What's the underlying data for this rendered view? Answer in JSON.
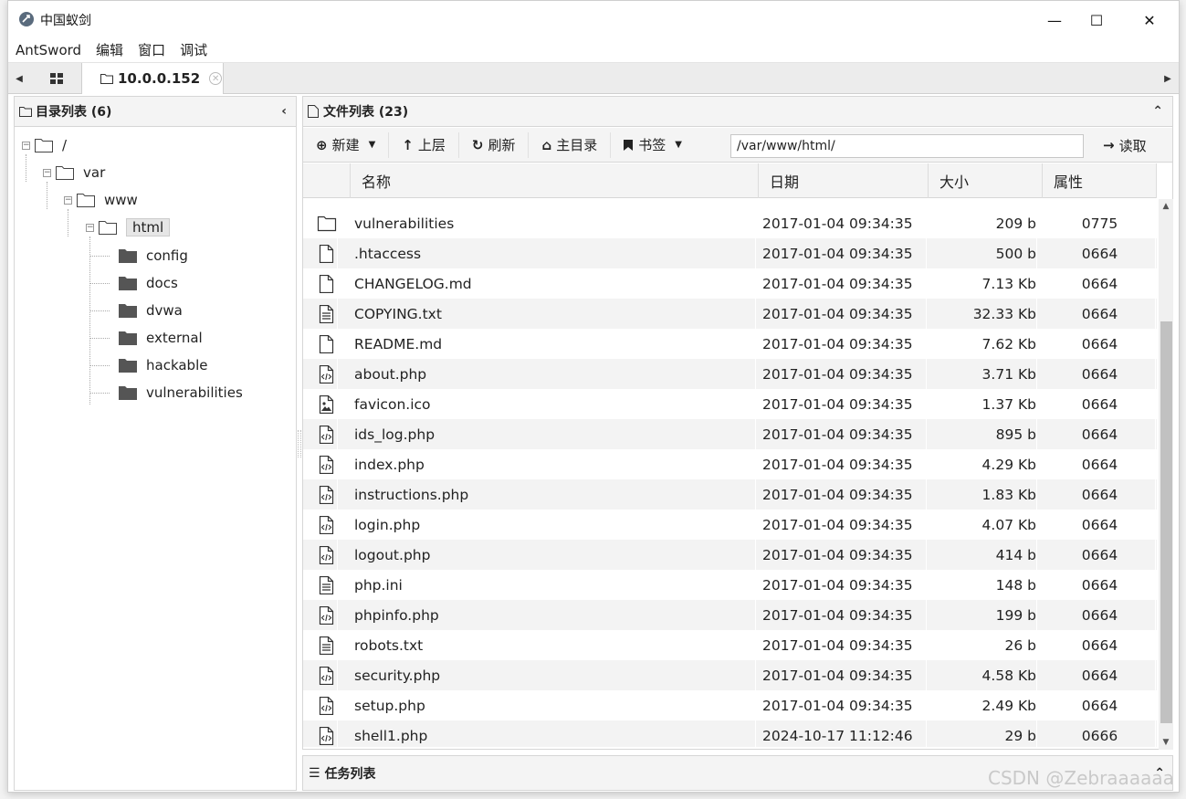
{
  "window": {
    "title": "中国蚁剑",
    "minimize": "—",
    "maximize": "☐",
    "close": "✕"
  },
  "menu": [
    "AntSword",
    "编辑",
    "窗口",
    "调试"
  ],
  "tabs": {
    "active_label": "10.0.0.152",
    "close_glyph": "✕"
  },
  "dir_panel": {
    "title": "目录列表 (6)",
    "collapse": "‹",
    "tree": [
      {
        "label": "/"
      },
      {
        "label": "var"
      },
      {
        "label": "www"
      },
      {
        "label": "html"
      },
      {
        "label": "config"
      },
      {
        "label": "docs"
      },
      {
        "label": "dvwa"
      },
      {
        "label": "external"
      },
      {
        "label": "hackable"
      },
      {
        "label": "vulnerabilities"
      }
    ]
  },
  "file_panel": {
    "title": "文件列表 (23)",
    "collapse": "⌃",
    "toolbar": {
      "new": "新建",
      "up": "上层",
      "refresh": "刷新",
      "home": "主目录",
      "bookmark": "书签",
      "path": "/var/www/html/",
      "read": "读取"
    },
    "columns": {
      "name": "名称",
      "date": "日期",
      "size": "大小",
      "attr": "属性"
    },
    "files": [
      {
        "icon": "folder",
        "name": "vulnerabilities",
        "date": "2017-01-04 09:34:35",
        "size": "209 b",
        "attr": "0775"
      },
      {
        "icon": "file",
        "name": ".htaccess",
        "date": "2017-01-04 09:34:35",
        "size": "500 b",
        "attr": "0664"
      },
      {
        "icon": "file",
        "name": "CHANGELOG.md",
        "date": "2017-01-04 09:34:35",
        "size": "7.13 Kb",
        "attr": "0664"
      },
      {
        "icon": "text",
        "name": "COPYING.txt",
        "date": "2017-01-04 09:34:35",
        "size": "32.33 Kb",
        "attr": "0664"
      },
      {
        "icon": "file",
        "name": "README.md",
        "date": "2017-01-04 09:34:35",
        "size": "7.62 Kb",
        "attr": "0664"
      },
      {
        "icon": "code",
        "name": "about.php",
        "date": "2017-01-04 09:34:35",
        "size": "3.71 Kb",
        "attr": "0664"
      },
      {
        "icon": "image",
        "name": "favicon.ico",
        "date": "2017-01-04 09:34:35",
        "size": "1.37 Kb",
        "attr": "0664"
      },
      {
        "icon": "code",
        "name": "ids_log.php",
        "date": "2017-01-04 09:34:35",
        "size": "895 b",
        "attr": "0664"
      },
      {
        "icon": "code",
        "name": "index.php",
        "date": "2017-01-04 09:34:35",
        "size": "4.29 Kb",
        "attr": "0664"
      },
      {
        "icon": "code",
        "name": "instructions.php",
        "date": "2017-01-04 09:34:35",
        "size": "1.83 Kb",
        "attr": "0664"
      },
      {
        "icon": "code",
        "name": "login.php",
        "date": "2017-01-04 09:34:35",
        "size": "4.07 Kb",
        "attr": "0664"
      },
      {
        "icon": "code",
        "name": "logout.php",
        "date": "2017-01-04 09:34:35",
        "size": "414 b",
        "attr": "0664"
      },
      {
        "icon": "text",
        "name": "php.ini",
        "date": "2017-01-04 09:34:35",
        "size": "148 b",
        "attr": "0664"
      },
      {
        "icon": "code",
        "name": "phpinfo.php",
        "date": "2017-01-04 09:34:35",
        "size": "199 b",
        "attr": "0664"
      },
      {
        "icon": "text",
        "name": "robots.txt",
        "date": "2017-01-04 09:34:35",
        "size": "26 b",
        "attr": "0664"
      },
      {
        "icon": "code",
        "name": "security.php",
        "date": "2017-01-04 09:34:35",
        "size": "4.58 Kb",
        "attr": "0664"
      },
      {
        "icon": "code",
        "name": "setup.php",
        "date": "2017-01-04 09:34:35",
        "size": "2.49 Kb",
        "attr": "0664"
      },
      {
        "icon": "code",
        "name": "shell1.php",
        "date": "2024-10-17 11:12:46",
        "size": "29 b",
        "attr": "0666"
      }
    ]
  },
  "task_panel": {
    "title": "任务列表",
    "collapse": "⌃"
  },
  "watermark": "CSDN @Zebraaaaaa"
}
